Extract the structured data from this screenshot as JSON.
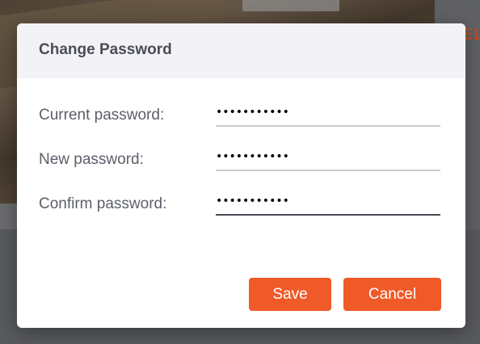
{
  "background": {
    "partial_text": "EL",
    "accent_color": "#c24a24"
  },
  "dialog": {
    "title": "Change Password",
    "fields": [
      {
        "label": "Current password:",
        "value": "•••••••••••",
        "type": "password"
      },
      {
        "label": "New password:",
        "value": "•••••••••••",
        "type": "password"
      },
      {
        "label": "Confirm password:",
        "value": "•••••••••••",
        "type": "password",
        "focused": true
      }
    ],
    "buttons": {
      "save_label": "Save",
      "cancel_label": "Cancel"
    },
    "colors": {
      "button_bg": "#f05a28",
      "header_bg": "#f3f3f7"
    }
  }
}
